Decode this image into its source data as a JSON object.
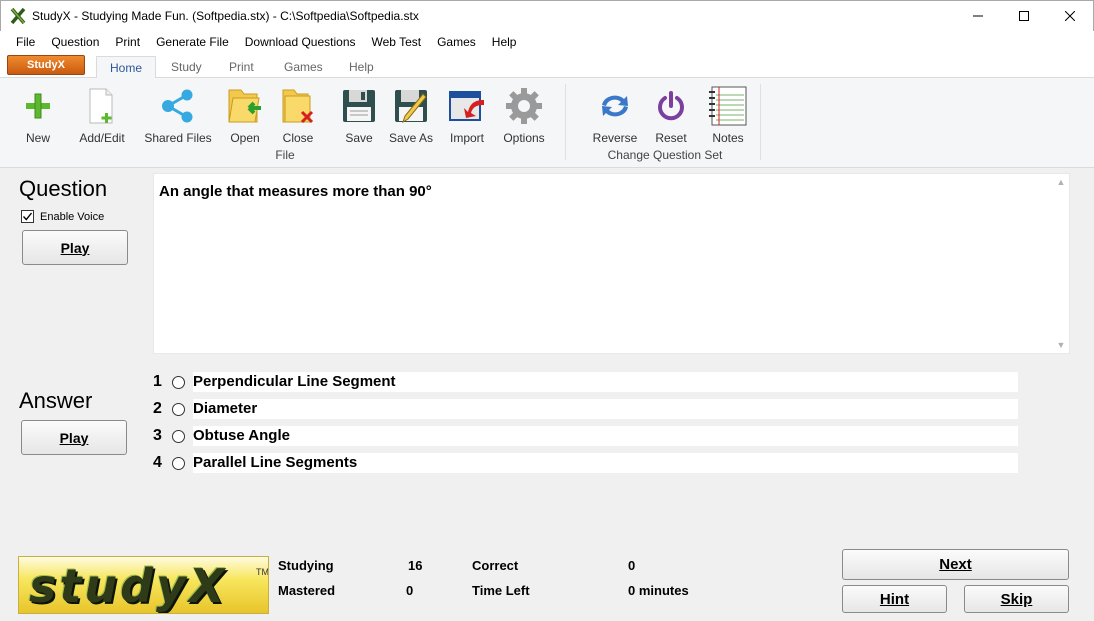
{
  "window": {
    "title": "StudyX - Studying Made Fun. (Softpedia.stx) - C:\\Softpedia\\Softpedia.stx"
  },
  "menu": [
    "File",
    "Question",
    "Print",
    "Generate File",
    "Download Questions",
    "Web Test",
    "Games",
    "Help"
  ],
  "ribbon": {
    "app_button": "StudyX",
    "tabs": [
      "Home",
      "Study",
      "Print",
      "Games",
      "Help"
    ],
    "active_tab": "Home",
    "file_group": {
      "label": "File",
      "buttons": [
        "New",
        "Add/Edit",
        "Shared Files",
        "Open",
        "Close",
        "Save",
        "Save As",
        "Import",
        "Options"
      ]
    },
    "question_set_group": {
      "label": "Change Question Set",
      "buttons": [
        "Reverse",
        "Reset",
        "Notes"
      ]
    }
  },
  "question": {
    "heading": "Question",
    "enable_voice_label": "Enable Voice",
    "enable_voice_checked": true,
    "play_label": "Play",
    "text": "An angle that measures more than 90°"
  },
  "answer": {
    "heading": "Answer",
    "play_label": "Play",
    "options": [
      {
        "num": "1",
        "text": "Perpendicular Line Segment"
      },
      {
        "num": "2",
        "text": "Diameter"
      },
      {
        "num": "3",
        "text": "Obtuse Angle"
      },
      {
        "num": "4",
        "text": "Parallel Line Segments"
      }
    ]
  },
  "logo": {
    "text": "studyX",
    "tm": "TM"
  },
  "stats": {
    "studying_label": "Studying",
    "studying_value": "16",
    "mastered_label": "Mastered",
    "mastered_value": "0",
    "correct_label": "Correct",
    "correct_value": "0",
    "time_left_label": "Time Left",
    "time_left_value": "0 minutes"
  },
  "buttons": {
    "next": "Next",
    "hint": "Hint",
    "skip": "Skip"
  }
}
